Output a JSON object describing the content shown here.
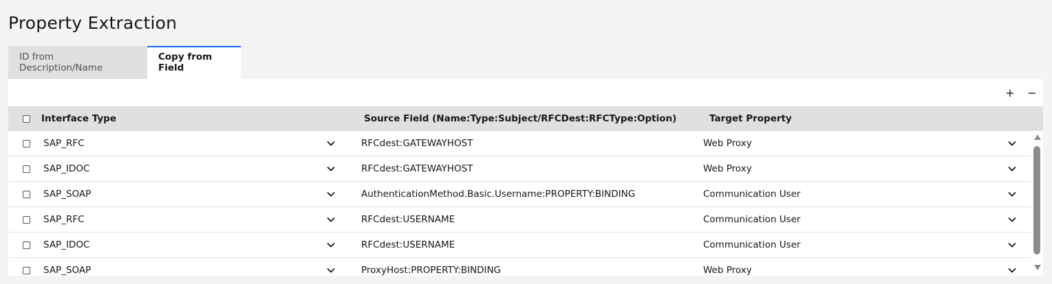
{
  "page": {
    "title": "Property Extraction"
  },
  "tabs": [
    {
      "label": "ID from Description/Name"
    },
    {
      "label": "Copy from Field"
    }
  ],
  "toolbar": {
    "add_symbol": "+",
    "remove_symbol": "−"
  },
  "table": {
    "headers": {
      "interface_type": "Interface Type",
      "source_field": "Source Field (Name:Type:Subject/RFCDest:RFCType:Option)",
      "target_property": "Target Property"
    },
    "rows": [
      {
        "interface_type": "SAP_RFC",
        "source_field": "RFCdest:GATEWAYHOST",
        "target_property": "Web Proxy"
      },
      {
        "interface_type": "SAP_IDOC",
        "source_field": "RFCdest:GATEWAYHOST",
        "target_property": "Web Proxy"
      },
      {
        "interface_type": "SAP_SOAP",
        "source_field": "AuthenticationMethod.Basic.Username:PROPERTY:BINDING",
        "target_property": "Communication User"
      },
      {
        "interface_type": "SAP_RFC",
        "source_field": "RFCdest:USERNAME",
        "target_property": "Communication User"
      },
      {
        "interface_type": "SAP_IDOC",
        "source_field": "RFCdest:USERNAME",
        "target_property": "Communication User"
      },
      {
        "interface_type": "SAP_SOAP",
        "source_field": "ProxyHost:PROPERTY:BINDING",
        "target_property": "Web Proxy"
      }
    ]
  },
  "colors": {
    "accent": "#0f62fe",
    "header_bg": "#e0e0e0",
    "page_bg": "#f4f4f4"
  },
  "icons": {
    "dropdown": "chevron-down-icon",
    "add": "add-icon",
    "remove": "remove-icon",
    "scroll_up": "caret-up-icon",
    "scroll_down": "caret-down-icon"
  }
}
